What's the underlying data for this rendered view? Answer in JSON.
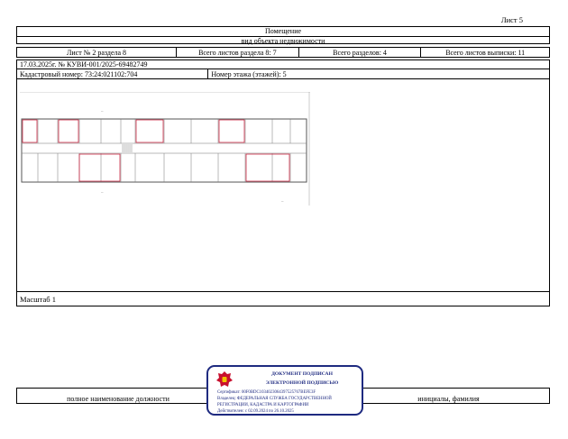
{
  "sheet_label": "Лист 5",
  "header": {
    "title": "Помещение",
    "subtitle": "вид объекта недвижимости"
  },
  "info_row": {
    "sheet_section": "Лист № 2 раздела 8",
    "total_sheets_section": "Всего листов раздела 8: 7",
    "total_sections": "Всего разделов: 4",
    "total_sheets_extract": "Всего листов выписки: 11"
  },
  "extract_id": "17.03.2025г. № КУВИ-001/2025-69482749",
  "cadastral": "Кадастровый номер: 73:24:021102:704",
  "floor": "Номер этажа (этажей): 5",
  "scale": "Масштаб 1",
  "signature": {
    "position_label": "полное наименование должности",
    "name_label": "инициалы, фамилия"
  },
  "stamp": {
    "line1": "ДОКУМЕНТ ПОДПИСАН",
    "line2": "ЭЛЕКТРОННОЙ ПОДПИСЬЮ",
    "certificate": "Сертификат: 00F0BDC1034023064397525767BEFE3F",
    "owner": "Владелец: ФЕДЕРАЛЬНАЯ СЛУЖБА ГОСУДАРСТВЕННОЙ",
    "owner2": "РЕГИСТРАЦИИ, КАДАСТРА И КАРТОГРАФИИ",
    "valid": "Действителен: с 02.09.2024 по 26.10.2025"
  },
  "colors": {
    "stamp_blue": "#1e2a80",
    "plan_red": "#c8102e"
  }
}
